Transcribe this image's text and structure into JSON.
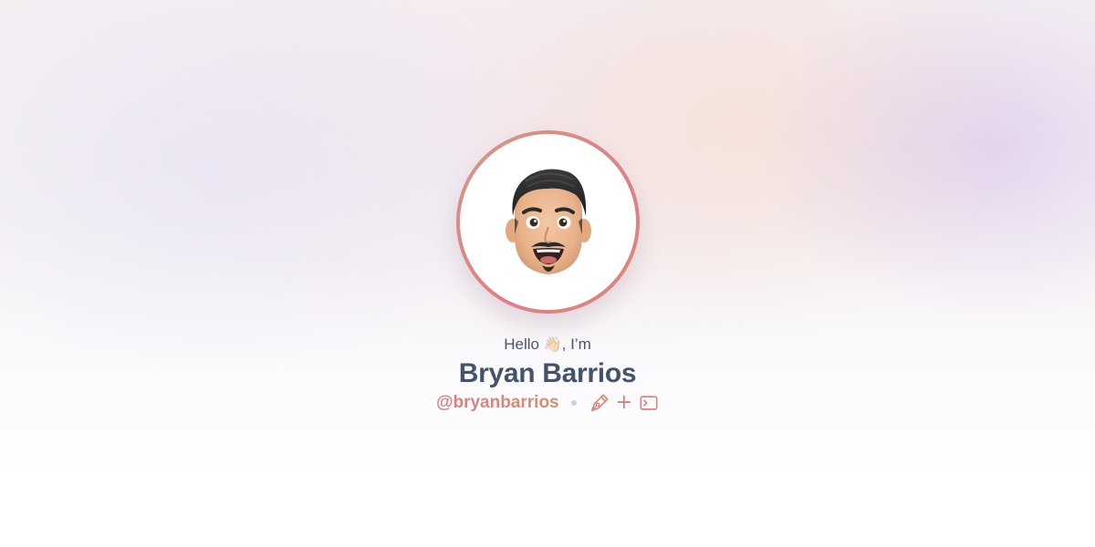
{
  "profile": {
    "greeting_prefix": "Hello",
    "greeting_wave": "👋🏻",
    "greeting_suffix": ", I’m",
    "name": "Bryan Barrios",
    "handle": "@bryanbarrios"
  },
  "icons": {
    "avatar": "memoji-avatar",
    "design": "pen-nib-icon",
    "plus": "+",
    "code": "terminal-icon"
  },
  "colors": {
    "accent_start": "#dd7d86",
    "accent_end": "#d98c72",
    "name_text": "#44536a",
    "greeting_text": "#4a5568",
    "separator": "#cbd2dc"
  }
}
